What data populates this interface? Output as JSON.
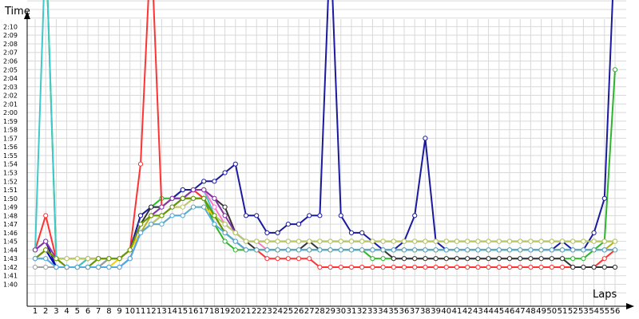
{
  "chart_data": {
    "type": "line",
    "xlabel": "Laps",
    "ylabel": "Time",
    "x_categories": [
      "1",
      "2",
      "3",
      "4",
      "5",
      "6",
      "7",
      "8",
      "9",
      "10",
      "11",
      "12",
      "13",
      "14",
      "15",
      "16",
      "17",
      "18",
      "19",
      "20",
      "21",
      "22",
      "23",
      "24",
      "25",
      "26",
      "27",
      "28",
      "29",
      "30",
      "31",
      "32",
      "33",
      "34",
      "35",
      "36",
      "37",
      "38",
      "39",
      "40",
      "41",
      "42",
      "43",
      "44",
      "45",
      "46",
      "47",
      "48",
      "49",
      "50",
      "51",
      "52",
      "53",
      "54",
      "55",
      "56"
    ],
    "y_ticks": [
      "1:40",
      "1:41",
      "1:42",
      "1:43",
      "1:44",
      "1:45",
      "1:46",
      "1:47",
      "1:48",
      "1:49",
      "1:50",
      "1:51",
      "1:52",
      "1:53",
      "1:54",
      "1:55",
      "1:56",
      "1:57",
      "1:58",
      "1:59",
      "2:00",
      "2:01",
      "2:02",
      "2:03",
      "2:04",
      "2:05",
      "2:06",
      "2:07",
      "2:08",
      "2:09",
      "2:10"
    ],
    "ylim_seconds": [
      99,
      137
    ],
    "grid": true,
    "series": [
      {
        "color": "#2db52d",
        "values": [
          null,
          140,
          103,
          102,
          102,
          102,
          103,
          103,
          103,
          104,
          108,
          109,
          110,
          110,
          111,
          111,
          110,
          107,
          105,
          104,
          104,
          104,
          104,
          104,
          104,
          104,
          104,
          104,
          104,
          104,
          104,
          104,
          103,
          103,
          103,
          103,
          103,
          103,
          103,
          103,
          103,
          103,
          103,
          103,
          103,
          103,
          103,
          103,
          103,
          103,
          103,
          103,
          103,
          104,
          105,
          125
        ]
      },
      {
        "color": "#ff3333",
        "values": [
          104,
          108,
          103,
          102,
          102,
          102,
          102,
          103,
          103,
          104,
          114,
          140,
          109,
          110,
          110,
          111,
          110,
          108,
          106,
          105,
          104,
          104,
          103,
          103,
          103,
          103,
          103,
          102,
          102,
          102,
          102,
          102,
          102,
          102,
          102,
          102,
          102,
          102,
          102,
          102,
          102,
          102,
          102,
          102,
          102,
          102,
          102,
          102,
          102,
          102,
          102,
          102,
          102,
          102,
          103,
          104
        ]
      },
      {
        "color": "#1a1aa0",
        "values": [
          104,
          105,
          102,
          102,
          102,
          103,
          103,
          103,
          103,
          104,
          108,
          109,
          109,
          110,
          111,
          111,
          112,
          112,
          113,
          114,
          108,
          108,
          106,
          106,
          107,
          107,
          108,
          108,
          140,
          108,
          106,
          106,
          105,
          104,
          104,
          105,
          108,
          117,
          105,
          104,
          104,
          104,
          104,
          104,
          104,
          104,
          104,
          104,
          104,
          104,
          105,
          104,
          104,
          106,
          110,
          140
        ]
      },
      {
        "color": "#333333",
        "values": [
          103,
          104,
          103,
          102,
          102,
          102,
          102,
          103,
          103,
          104,
          107,
          109,
          109,
          110,
          110,
          111,
          111,
          110,
          109,
          106,
          105,
          104,
          104,
          104,
          104,
          104,
          105,
          104,
          104,
          104,
          104,
          104,
          104,
          104,
          103,
          103,
          103,
          103,
          103,
          103,
          103,
          103,
          103,
          103,
          103,
          103,
          103,
          103,
          103,
          103,
          103,
          102,
          102,
          102,
          102,
          102
        ]
      },
      {
        "color": "#3fc9c9",
        "values": [
          104,
          140,
          103,
          102,
          102,
          103,
          103,
          103,
          103,
          104,
          107,
          108,
          109,
          110,
          110,
          111,
          111,
          108,
          107,
          106,
          105,
          105,
          105,
          105,
          105,
          105,
          105,
          105,
          105,
          105,
          105,
          105,
          105,
          105,
          105,
          105,
          105,
          105,
          105,
          105,
          105,
          105,
          105,
          105,
          105,
          105,
          105,
          105,
          105,
          105,
          105,
          105,
          105,
          105,
          105,
          105
        ]
      },
      {
        "color": "#b3b31a",
        "values": [
          103,
          103,
          102,
          102,
          102,
          102,
          103,
          103,
          103,
          104,
          106,
          108,
          108,
          109,
          110,
          110,
          110,
          108,
          106,
          105,
          104,
          104,
          104,
          104,
          104,
          104,
          104,
          104,
          104,
          104,
          104,
          104,
          104,
          104,
          104,
          104,
          104,
          104,
          104,
          104,
          104,
          104,
          104,
          104,
          104,
          104,
          104,
          104,
          104,
          104,
          104,
          104,
          104,
          104,
          104,
          105
        ]
      },
      {
        "color": "#a0a0a0",
        "values": [
          102,
          102,
          102,
          102,
          102,
          102,
          102,
          103,
          103,
          104,
          106,
          107,
          108,
          109,
          109,
          110,
          110,
          108,
          106,
          105,
          104,
          104,
          104,
          104,
          104,
          104,
          104,
          104,
          104,
          104,
          104,
          104,
          104,
          104,
          104,
          104,
          104,
          104,
          104,
          104,
          104,
          104,
          104,
          104,
          104,
          104,
          104,
          104,
          104,
          104,
          104,
          104,
          104,
          104,
          104,
          104
        ]
      },
      {
        "color": "#ff77cc",
        "values": [
          103,
          104,
          103,
          102,
          102,
          102,
          103,
          103,
          103,
          104,
          107,
          108,
          109,
          110,
          110,
          111,
          111,
          109,
          107,
          106,
          105,
          105,
          104,
          104,
          104,
          104,
          104,
          104,
          104,
          104,
          104,
          104,
          104,
          104,
          104,
          104,
          104,
          104,
          104,
          104,
          104,
          104,
          104,
          104,
          104,
          104,
          104,
          104,
          104,
          104,
          104,
          104,
          104,
          104,
          104,
          104
        ]
      },
      {
        "color": "#8833aa",
        "values": [
          104,
          105,
          103,
          103,
          103,
          103,
          103,
          103,
          103,
          104,
          107,
          108,
          109,
          110,
          110,
          111,
          111,
          110,
          108,
          106,
          105,
          105,
          105,
          105,
          105,
          105,
          105,
          105,
          105,
          105,
          105,
          105,
          105,
          105,
          105,
          105,
          105,
          105,
          105,
          105,
          105,
          105,
          105,
          105,
          105,
          105,
          105,
          105,
          105,
          105,
          105,
          105,
          105,
          105,
          105,
          105
        ]
      },
      {
        "color": "#0000cc",
        "values": [
          103,
          104,
          102,
          102,
          102,
          102,
          102,
          102,
          102,
          103,
          106,
          107,
          108,
          109,
          110,
          110,
          110,
          108,
          106,
          105,
          104,
          104,
          104,
          104,
          104,
          104,
          104,
          104,
          104,
          104,
          104,
          104,
          104,
          104,
          104,
          104,
          104,
          104,
          104,
          104,
          104,
          104,
          104,
          104,
          104,
          104,
          104,
          104,
          104,
          104,
          104,
          104,
          104,
          104,
          104,
          104
        ]
      },
      {
        "color": "#bbcc66",
        "values": [
          103,
          104,
          103,
          103,
          103,
          103,
          103,
          103,
          103,
          104,
          106,
          107,
          108,
          109,
          109,
          110,
          110,
          108,
          107,
          106,
          105,
          105,
          105,
          105,
          105,
          105,
          105,
          105,
          105,
          105,
          105,
          105,
          105,
          105,
          105,
          105,
          105,
          105,
          105,
          105,
          105,
          105,
          105,
          105,
          105,
          105,
          105,
          105,
          105,
          105,
          105,
          105,
          105,
          105,
          105,
          105
        ]
      },
      {
        "color": "#ffcc00",
        "values": [
          103,
          104,
          103,
          102,
          102,
          102,
          102,
          102,
          103,
          104,
          106,
          107,
          107,
          108,
          108,
          109,
          109,
          108,
          106,
          105,
          104,
          104,
          104,
          104,
          104,
          104,
          104,
          104,
          104,
          104,
          104,
          104,
          104,
          104,
          104,
          104,
          104,
          104,
          104,
          104,
          104,
          104,
          104,
          104,
          104,
          104,
          104,
          104,
          104,
          104,
          104,
          104,
          104,
          104,
          104,
          104
        ]
      },
      {
        "color": "#669900",
        "values": [
          103,
          104,
          103,
          102,
          102,
          102,
          103,
          103,
          103,
          104,
          107,
          108,
          108,
          109,
          110,
          110,
          110,
          108,
          106,
          105,
          104,
          104,
          104,
          104,
          104,
          104,
          104,
          104,
          104,
          104,
          104,
          104,
          104,
          104,
          104,
          104,
          104,
          104,
          104,
          104,
          104,
          104,
          104,
          104,
          104,
          104,
          104,
          104,
          104,
          104,
          104,
          104,
          104,
          104,
          104,
          104
        ]
      },
      {
        "color": "#55aadd",
        "values": [
          103,
          103,
          102,
          102,
          102,
          102,
          102,
          102,
          102,
          103,
          106,
          107,
          107,
          108,
          108,
          109,
          109,
          107,
          106,
          105,
          104,
          104,
          104,
          104,
          104,
          104,
          104,
          104,
          104,
          104,
          104,
          104,
          104,
          104,
          104,
          104,
          104,
          104,
          104,
          104,
          104,
          104,
          104,
          104,
          104,
          104,
          104,
          104,
          104,
          104,
          104,
          104,
          104,
          104,
          104,
          104
        ]
      }
    ]
  }
}
